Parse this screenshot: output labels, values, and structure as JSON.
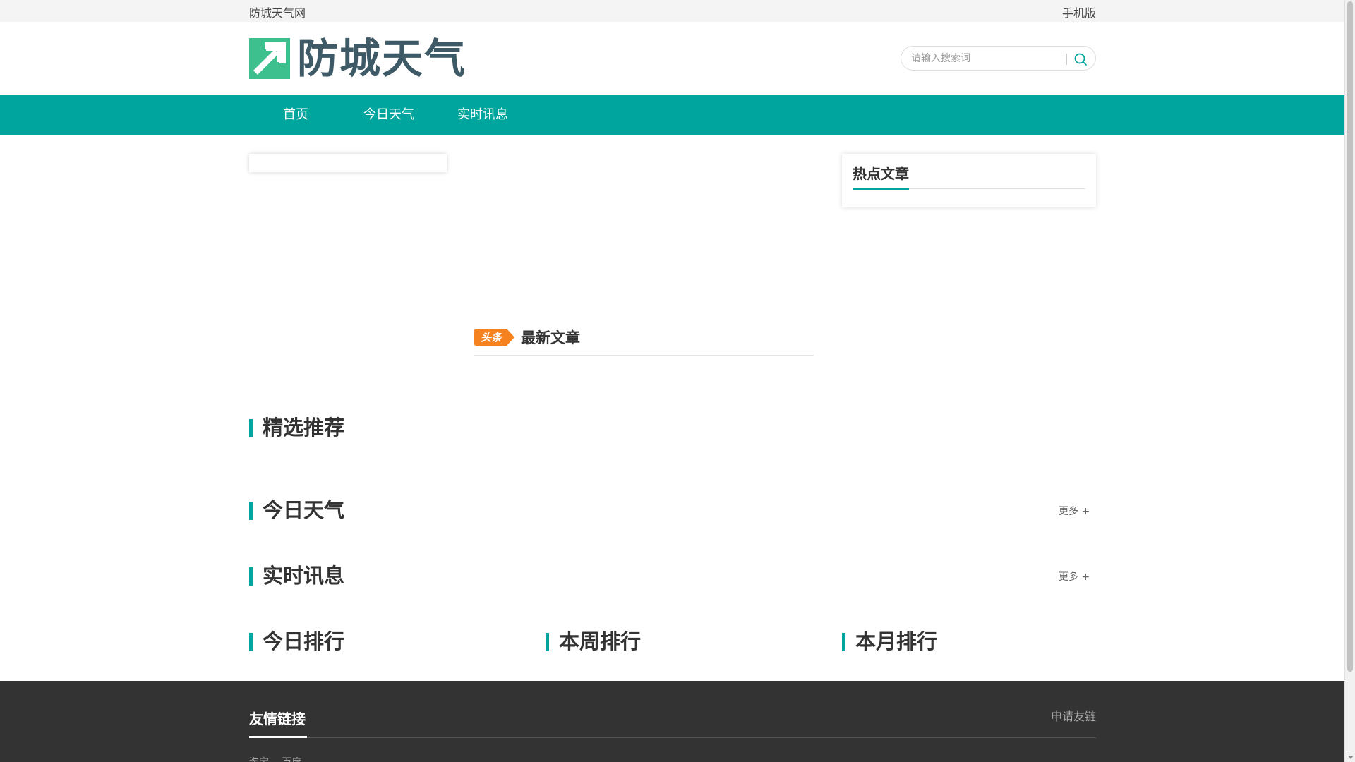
{
  "topbar": {
    "site_name": "防城天气网",
    "mobile_label": "手机版"
  },
  "header": {
    "logo_text": "防城天气",
    "search_placeholder": "请输入搜索词"
  },
  "nav": {
    "items": [
      "首页",
      "今日天气",
      "实时讯息"
    ]
  },
  "hot": {
    "title": "热点文章"
  },
  "latest": {
    "badge": "头条",
    "title": "最新文章"
  },
  "sections": {
    "featured": "精选推荐",
    "today_weather": "今日天气",
    "realtime": "实时讯息",
    "more": "更多 +",
    "rank_today": "今日排行",
    "rank_week": "本周排行",
    "rank_month": "本月排行"
  },
  "footer": {
    "friend_title": "友情链接",
    "apply_label": "申请友链",
    "links": [
      "淘宝",
      "百度"
    ]
  },
  "colors": {
    "accent": "#00a59e",
    "logo_green": "#3dbf8e",
    "badge_orange": "#f5821f",
    "footer_bg": "#333333"
  },
  "icons": {
    "search": "search-icon",
    "logo": "logo-arrow-icon"
  }
}
